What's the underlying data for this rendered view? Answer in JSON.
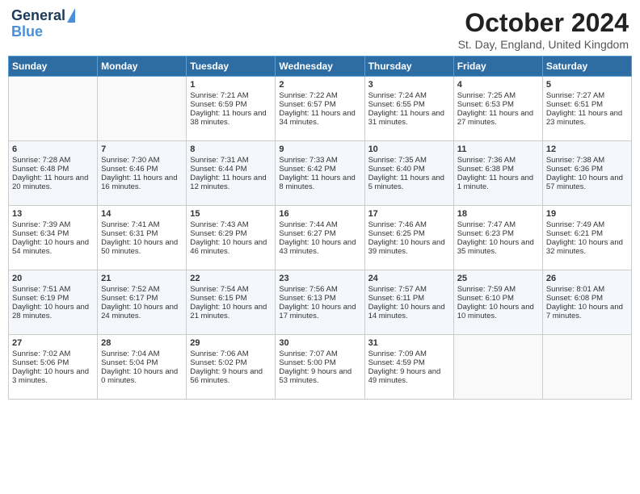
{
  "header": {
    "logo_line1": "General",
    "logo_line2": "Blue",
    "month": "October 2024",
    "location": "St. Day, England, United Kingdom"
  },
  "weekdays": [
    "Sunday",
    "Monday",
    "Tuesday",
    "Wednesday",
    "Thursday",
    "Friday",
    "Saturday"
  ],
  "weeks": [
    [
      {
        "day": "",
        "info": ""
      },
      {
        "day": "",
        "info": ""
      },
      {
        "day": "1",
        "info": "Sunrise: 7:21 AM\nSunset: 6:59 PM\nDaylight: 11 hours and 38 minutes."
      },
      {
        "day": "2",
        "info": "Sunrise: 7:22 AM\nSunset: 6:57 PM\nDaylight: 11 hours and 34 minutes."
      },
      {
        "day": "3",
        "info": "Sunrise: 7:24 AM\nSunset: 6:55 PM\nDaylight: 11 hours and 31 minutes."
      },
      {
        "day": "4",
        "info": "Sunrise: 7:25 AM\nSunset: 6:53 PM\nDaylight: 11 hours and 27 minutes."
      },
      {
        "day": "5",
        "info": "Sunrise: 7:27 AM\nSunset: 6:51 PM\nDaylight: 11 hours and 23 minutes."
      }
    ],
    [
      {
        "day": "6",
        "info": "Sunrise: 7:28 AM\nSunset: 6:48 PM\nDaylight: 11 hours and 20 minutes."
      },
      {
        "day": "7",
        "info": "Sunrise: 7:30 AM\nSunset: 6:46 PM\nDaylight: 11 hours and 16 minutes."
      },
      {
        "day": "8",
        "info": "Sunrise: 7:31 AM\nSunset: 6:44 PM\nDaylight: 11 hours and 12 minutes."
      },
      {
        "day": "9",
        "info": "Sunrise: 7:33 AM\nSunset: 6:42 PM\nDaylight: 11 hours and 8 minutes."
      },
      {
        "day": "10",
        "info": "Sunrise: 7:35 AM\nSunset: 6:40 PM\nDaylight: 11 hours and 5 minutes."
      },
      {
        "day": "11",
        "info": "Sunrise: 7:36 AM\nSunset: 6:38 PM\nDaylight: 11 hours and 1 minute."
      },
      {
        "day": "12",
        "info": "Sunrise: 7:38 AM\nSunset: 6:36 PM\nDaylight: 10 hours and 57 minutes."
      }
    ],
    [
      {
        "day": "13",
        "info": "Sunrise: 7:39 AM\nSunset: 6:34 PM\nDaylight: 10 hours and 54 minutes."
      },
      {
        "day": "14",
        "info": "Sunrise: 7:41 AM\nSunset: 6:31 PM\nDaylight: 10 hours and 50 minutes."
      },
      {
        "day": "15",
        "info": "Sunrise: 7:43 AM\nSunset: 6:29 PM\nDaylight: 10 hours and 46 minutes."
      },
      {
        "day": "16",
        "info": "Sunrise: 7:44 AM\nSunset: 6:27 PM\nDaylight: 10 hours and 43 minutes."
      },
      {
        "day": "17",
        "info": "Sunrise: 7:46 AM\nSunset: 6:25 PM\nDaylight: 10 hours and 39 minutes."
      },
      {
        "day": "18",
        "info": "Sunrise: 7:47 AM\nSunset: 6:23 PM\nDaylight: 10 hours and 35 minutes."
      },
      {
        "day": "19",
        "info": "Sunrise: 7:49 AM\nSunset: 6:21 PM\nDaylight: 10 hours and 32 minutes."
      }
    ],
    [
      {
        "day": "20",
        "info": "Sunrise: 7:51 AM\nSunset: 6:19 PM\nDaylight: 10 hours and 28 minutes."
      },
      {
        "day": "21",
        "info": "Sunrise: 7:52 AM\nSunset: 6:17 PM\nDaylight: 10 hours and 24 minutes."
      },
      {
        "day": "22",
        "info": "Sunrise: 7:54 AM\nSunset: 6:15 PM\nDaylight: 10 hours and 21 minutes."
      },
      {
        "day": "23",
        "info": "Sunrise: 7:56 AM\nSunset: 6:13 PM\nDaylight: 10 hours and 17 minutes."
      },
      {
        "day": "24",
        "info": "Sunrise: 7:57 AM\nSunset: 6:11 PM\nDaylight: 10 hours and 14 minutes."
      },
      {
        "day": "25",
        "info": "Sunrise: 7:59 AM\nSunset: 6:10 PM\nDaylight: 10 hours and 10 minutes."
      },
      {
        "day": "26",
        "info": "Sunrise: 8:01 AM\nSunset: 6:08 PM\nDaylight: 10 hours and 7 minutes."
      }
    ],
    [
      {
        "day": "27",
        "info": "Sunrise: 7:02 AM\nSunset: 5:06 PM\nDaylight: 10 hours and 3 minutes."
      },
      {
        "day": "28",
        "info": "Sunrise: 7:04 AM\nSunset: 5:04 PM\nDaylight: 10 hours and 0 minutes."
      },
      {
        "day": "29",
        "info": "Sunrise: 7:06 AM\nSunset: 5:02 PM\nDaylight: 9 hours and 56 minutes."
      },
      {
        "day": "30",
        "info": "Sunrise: 7:07 AM\nSunset: 5:00 PM\nDaylight: 9 hours and 53 minutes."
      },
      {
        "day": "31",
        "info": "Sunrise: 7:09 AM\nSunset: 4:59 PM\nDaylight: 9 hours and 49 minutes."
      },
      {
        "day": "",
        "info": ""
      },
      {
        "day": "",
        "info": ""
      }
    ]
  ]
}
